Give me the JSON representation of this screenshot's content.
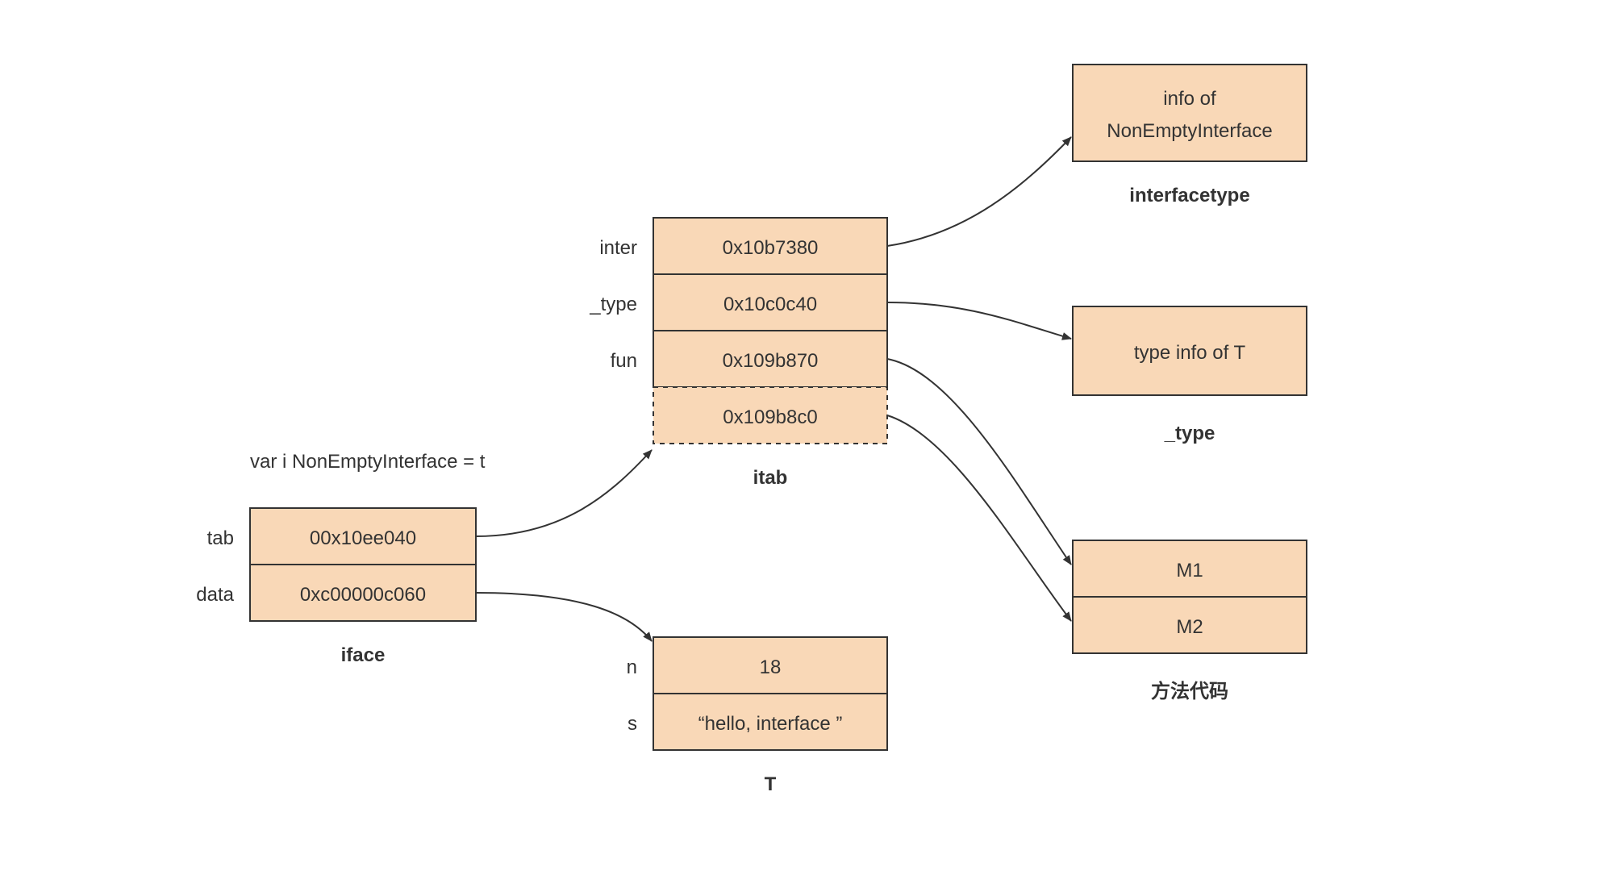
{
  "declaration": "var i NonEmptyInterface = t",
  "iface": {
    "caption": "iface",
    "rows": [
      {
        "label": "tab",
        "value": "00x10ee040"
      },
      {
        "label": "data",
        "value": "0xc00000c060"
      }
    ]
  },
  "itab": {
    "caption": "itab",
    "rows": [
      {
        "label": "inter",
        "value": "0x10b7380"
      },
      {
        "label": "_type",
        "value": "0x10c0c40"
      },
      {
        "label": "fun",
        "value": "0x109b870"
      },
      {
        "label": "",
        "value": "0x109b8c0",
        "dashed": true
      }
    ]
  },
  "T": {
    "caption": "T",
    "rows": [
      {
        "label": "n",
        "value": "18"
      },
      {
        "label": "s",
        "value": "“hello, interface ”"
      }
    ]
  },
  "interfacetype": {
    "caption": "interfacetype",
    "lines": [
      "info of",
      "NonEmptyInterface"
    ]
  },
  "type_box": {
    "caption": "_type",
    "lines": [
      "type info of T"
    ]
  },
  "methods": {
    "caption": "方法代码",
    "rows": [
      "M1",
      "M2"
    ]
  }
}
